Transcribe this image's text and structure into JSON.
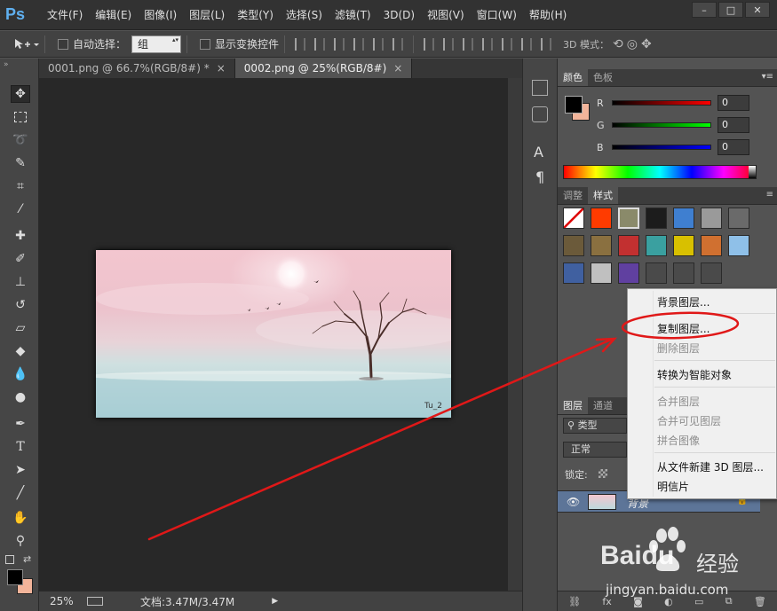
{
  "app": {
    "logo": "Ps"
  },
  "menu": [
    "文件(F)",
    "编辑(E)",
    "图像(I)",
    "图层(L)",
    "类型(Y)",
    "选择(S)",
    "滤镜(T)",
    "3D(D)",
    "视图(V)",
    "窗口(W)",
    "帮助(H)"
  ],
  "window_buttons": [
    "–",
    "□",
    "✕"
  ],
  "options": {
    "auto_select_label": "自动选择：",
    "auto_select_value": "组",
    "show_transform_label": "显示变换控件",
    "mode_3d_label": "3D 模式："
  },
  "tabs": [
    {
      "label": "0001.png @ 66.7%(RGB/8#) *",
      "close": "×",
      "active": false
    },
    {
      "label": "0002.png @ 25%(RGB/8#)",
      "close": "×",
      "active": true
    }
  ],
  "tools": [
    "move-tool",
    "marquee-tool",
    "lasso-tool",
    "quick-select-tool",
    "crop-tool",
    "eyedropper-tool",
    "healing-tool",
    "brush-tool",
    "stamp-tool",
    "history-brush-tool",
    "eraser-tool",
    "paint-bucket-tool",
    "blur-tool",
    "dodge-tool",
    "pen-tool",
    "type-tool",
    "path-select-tool",
    "line-tool",
    "hand-tool",
    "zoom-tool"
  ],
  "document": {
    "caption": "Tu_2"
  },
  "status": {
    "zoom": "25%",
    "doc_info": "文档:3.47M/3.47M"
  },
  "side_strip": {
    "char_icon": "A",
    "para_icon": "¶"
  },
  "color_panel": {
    "tabs": [
      "颜色",
      "色板"
    ],
    "channels": [
      {
        "label": "R",
        "value": "0",
        "color": "#ff0000"
      },
      {
        "label": "G",
        "value": "0",
        "color": "#00ff00"
      },
      {
        "label": "B",
        "value": "0",
        "color": "#0000ff"
      }
    ],
    "foreground": "#000000",
    "background": "#f2b49a"
  },
  "styles_panel": {
    "tabs": [
      "调整",
      "样式"
    ]
  },
  "layers_panel": {
    "tabs": [
      "图层",
      "通道"
    ],
    "filter_label": "类型",
    "blend_mode": "正常",
    "lock_label": "锁定:",
    "layer_name": "背景"
  },
  "context_menu": {
    "items": [
      {
        "label": "背景图层...",
        "disabled": false
      },
      {
        "label": "复制图层...",
        "disabled": false,
        "highlighted": true
      },
      {
        "label": "删除图层",
        "disabled": true
      },
      {
        "label": "转换为智能对象",
        "disabled": false
      },
      {
        "label": "合并图层",
        "disabled": true
      },
      {
        "label": "合并可见图层",
        "disabled": true
      },
      {
        "label": "拼合图像",
        "disabled": true
      },
      {
        "label": "从文件新建 3D 图层...",
        "disabled": false
      },
      {
        "label": "明信片",
        "disabled": false
      }
    ]
  },
  "annotation": {
    "color": "#e01818"
  },
  "watermark": {
    "brand": "Baidu",
    "brand_cn": "经验",
    "url": "jingyan.baidu.com"
  }
}
